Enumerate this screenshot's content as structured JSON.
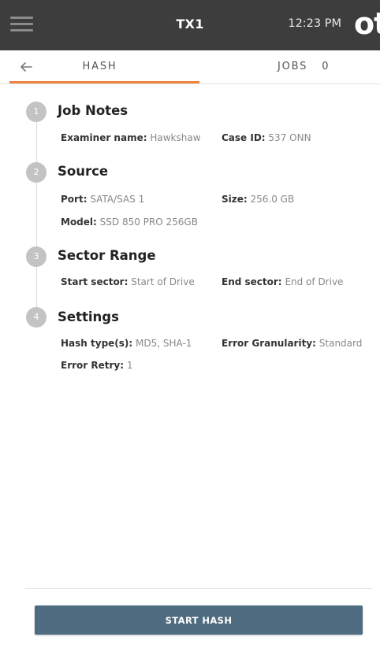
{
  "header": {
    "app_name": "TX1",
    "time": "12:23 PM",
    "logo_text": "ot"
  },
  "tabs": {
    "hash_label": "HASH",
    "jobs_label": "JOBS",
    "jobs_count": "0"
  },
  "steps": [
    {
      "number": "1",
      "title": "Job Notes",
      "fields": [
        {
          "key": "Examiner name:",
          "value": "Hawkshaw"
        },
        {
          "key": "Case ID:",
          "value": "537 ONN"
        }
      ]
    },
    {
      "number": "2",
      "title": "Source",
      "fields": [
        {
          "key": "Port:",
          "value": "SATA/SAS 1"
        },
        {
          "key": "Size:",
          "value": "256.0 GB"
        },
        {
          "key": "Model:",
          "value": "SSD 850 PRO 256GB"
        }
      ]
    },
    {
      "number": "3",
      "title": "Sector Range",
      "fields": [
        {
          "key": "Start sector:",
          "value": "Start of Drive"
        },
        {
          "key": "End sector:",
          "value": "End of Drive"
        }
      ]
    },
    {
      "number": "4",
      "title": "Settings",
      "fields": [
        {
          "key": "Hash type(s):",
          "value": "MD5, SHA-1"
        },
        {
          "key": "Error Granularity:",
          "value": "Standard"
        },
        {
          "key": "Error Retry:",
          "value": "1"
        }
      ]
    }
  ],
  "actions": {
    "start_label": "START HASH"
  },
  "icons": {
    "menu": "hamburger-menu-icon",
    "back": "arrow-left-icon"
  },
  "colors": {
    "header_bg": "#3d3d3d",
    "tab_underline": "#f08240",
    "step_badge": "#c3c3c3",
    "button_bg": "#4f6b7f"
  }
}
